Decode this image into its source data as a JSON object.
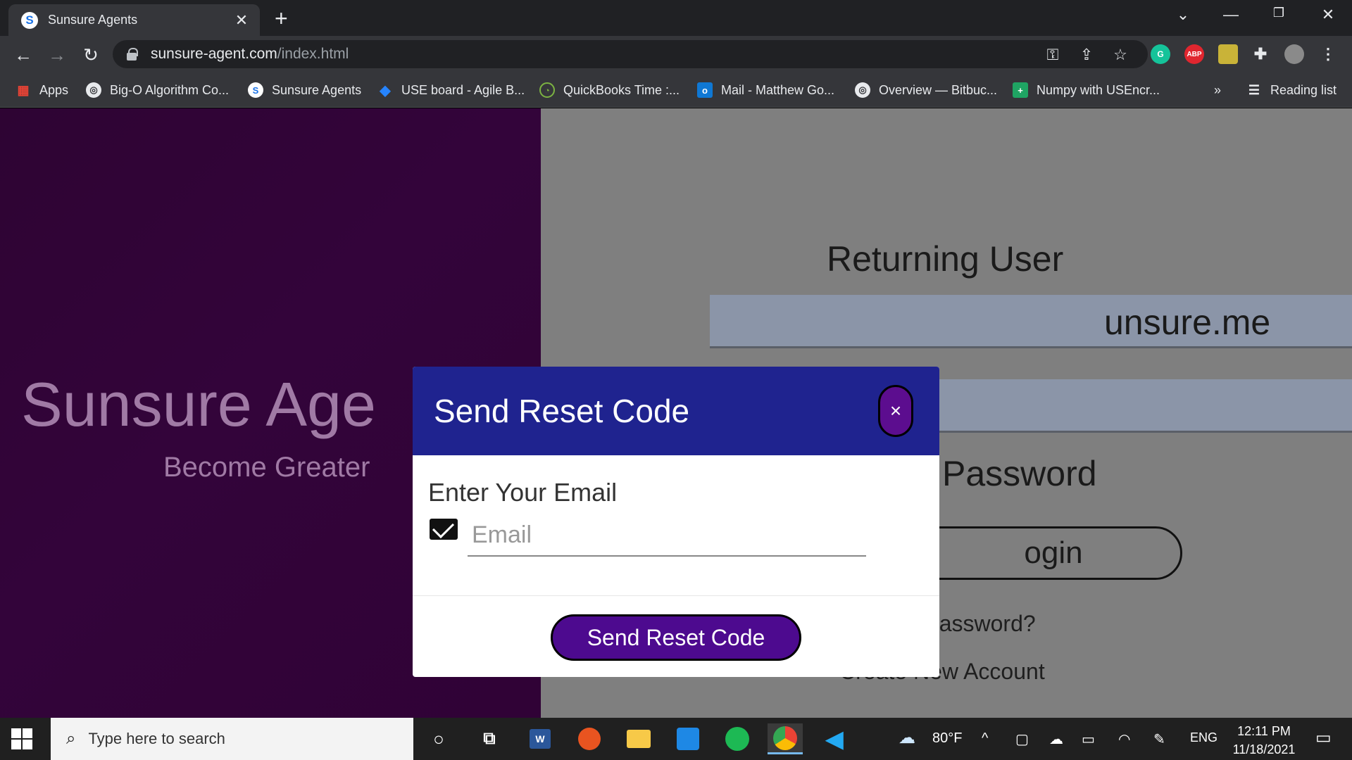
{
  "browser": {
    "tab_title": "Sunsure Agents",
    "tab_favicon_letter": "S",
    "url_host": "sunsure-agent.com",
    "url_path": "/index.html"
  },
  "bookmarks": [
    {
      "label": "Apps",
      "icon": "apps-grid-icon"
    },
    {
      "label": "Big-O Algorithm Co...",
      "icon": "globe-icon"
    },
    {
      "label": "Sunsure Agents",
      "icon": "sunsure-icon"
    },
    {
      "label": "USE board - Agile B...",
      "icon": "jira-icon"
    },
    {
      "label": "QuickBooks Time :...",
      "icon": "quickbooks-icon"
    },
    {
      "label": "Mail - Matthew Go...",
      "icon": "outlook-icon"
    },
    {
      "label": "Overview — Bitbuc...",
      "icon": "globe-icon"
    },
    {
      "label": "Numpy with USEncr...",
      "icon": "sheets-icon"
    }
  ],
  "bookmarks_overflow": "»",
  "reading_list": "Reading list",
  "extensions": [
    {
      "label": "G",
      "color": "#15c39a"
    },
    {
      "label": "ABP",
      "color": "#e0262f"
    }
  ],
  "page": {
    "brand": "Sunsure Age",
    "tagline": "Become Greater",
    "login_title": "Returning User",
    "email_value_visible": "unsure.me",
    "remember_text": "Password",
    "login_button": "ogin",
    "forgot_link": "Forgot Password?",
    "create_link": "Create New Account"
  },
  "modal": {
    "title": "Send Reset Code",
    "close_label": "×",
    "field_label": "Enter Your Email",
    "email_placeholder": "Email",
    "email_value": "",
    "submit_label": "Send Reset Code"
  },
  "taskbar": {
    "search_placeholder": "Type here to search",
    "weather": "80°F",
    "language": "ENG",
    "time": "12:11 PM",
    "date": "11/18/2021"
  },
  "colors": {
    "modal_header": "#1f238f",
    "accent_purple": "#4d0a8f",
    "left_pane": "#2e0433"
  }
}
